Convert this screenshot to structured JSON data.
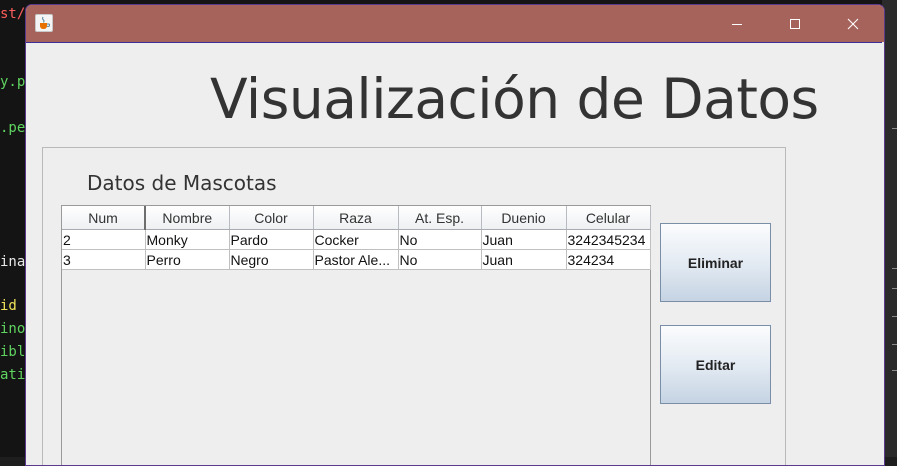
{
  "editor_fragments": [
    {
      "text": "st/",
      "color": "#ff5c5c"
    },
    {
      "text": "y.p",
      "color": "#5fd35f"
    },
    {
      "text": ".pe",
      "color": "#5fd35f"
    },
    {
      "text": "ina",
      "color": "#e8e8e8"
    },
    {
      "text": "id ",
      "color": "#f0e35a"
    },
    {
      "text": "ino",
      "color": "#5fd35f"
    },
    {
      "text": "ibl",
      "color": "#5fd35f"
    },
    {
      "text": "ati",
      "color": "#5fd35f"
    }
  ],
  "window": {
    "title_icon": "java-cup-icon",
    "controls": {
      "minimize_icon": "minimize-icon",
      "maximize_icon": "maximize-icon",
      "close_icon": "close-icon"
    }
  },
  "page_title": "Visualización de Datos",
  "panel_title": "Datos de Mascotas",
  "table": {
    "columns": [
      "Num",
      "Nombre",
      "Color",
      "Raza",
      "At. Esp.",
      "Duenio",
      "Celular"
    ],
    "rows": [
      [
        "2",
        "Monky",
        "Pardo",
        "Cocker",
        "No",
        "Juan",
        "3242345234"
      ],
      [
        "3",
        "Perro",
        "Negro",
        "Pastor Ale...",
        "No",
        "Juan",
        "324234"
      ]
    ]
  },
  "buttons": {
    "delete_label": "Eliminar",
    "edit_label": "Editar"
  },
  "colors": {
    "titlebar": "#a6635b",
    "window_bg": "#eeeeee",
    "button_gradient_bottom": "#c5d3e3"
  }
}
